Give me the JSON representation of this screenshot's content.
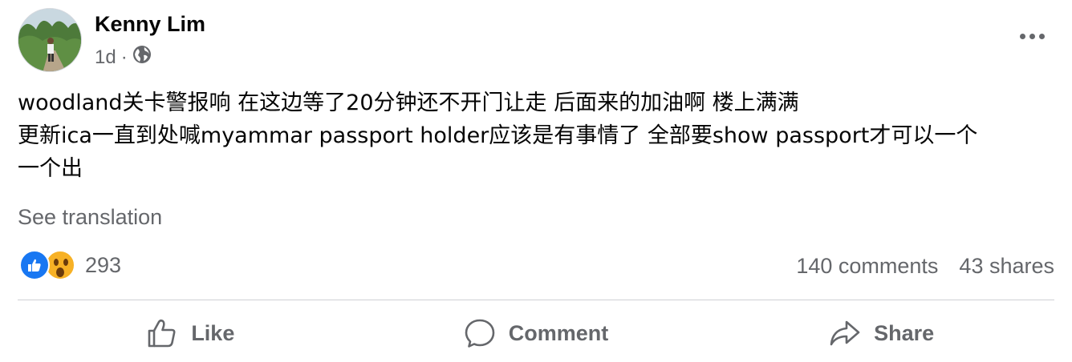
{
  "post": {
    "author": "Kenny Lim",
    "time": "1d",
    "separator": "·",
    "privacy_icon": "globe-icon",
    "text_lines": [
      "woodland关卡警报响 在这边等了20分钟还不开门让走 后面来的加油啊 楼上满满",
      "更新ica一直到处喊myammar passport holder应该是有事情了 全部要show passport才可以一个",
      "一个出"
    ],
    "see_translation": "See translation"
  },
  "engagement": {
    "reaction_icons": [
      "like-reaction-icon",
      "wow-reaction-icon"
    ],
    "reaction_count": "293",
    "comments": "140 comments",
    "shares": "43 shares"
  },
  "actions": {
    "like": "Like",
    "comment": "Comment",
    "share": "Share"
  },
  "colors": {
    "accent": "#1877f2",
    "secondary_text": "#65676b",
    "divider": "#ced0d4",
    "wow_yellow": "#f7b125"
  }
}
